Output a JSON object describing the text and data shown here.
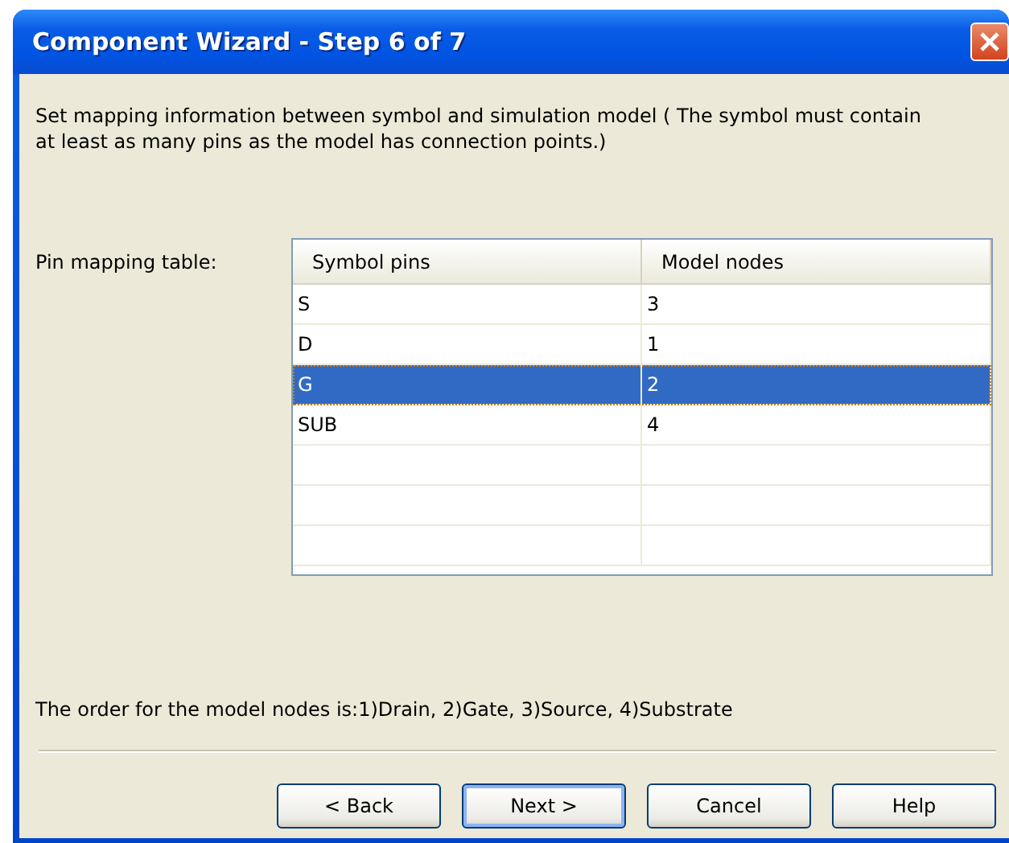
{
  "window": {
    "title": "Component Wizard - Step 6 of 7"
  },
  "description": "Set mapping information between symbol and simulation model ( The symbol must contain at least as many pins as the model has connection points.)",
  "table_label": "Pin mapping table:",
  "table": {
    "columns": [
      "Symbol pins",
      "Model nodes"
    ],
    "rows": [
      {
        "cells": [
          "S",
          "3"
        ],
        "selected": false
      },
      {
        "cells": [
          "D",
          "1"
        ],
        "selected": false
      },
      {
        "cells": [
          "G",
          "2"
        ],
        "selected": true
      },
      {
        "cells": [
          "SUB",
          "4"
        ],
        "selected": false
      }
    ]
  },
  "note": "The order for the model nodes is:1)Drain, 2)Gate, 3)Source, 4)Substrate",
  "buttons": [
    {
      "label": "< Back",
      "default": false
    },
    {
      "label": "Next >",
      "default": true
    },
    {
      "label": "Cancel",
      "default": false
    },
    {
      "label": "Help",
      "default": false
    }
  ]
}
